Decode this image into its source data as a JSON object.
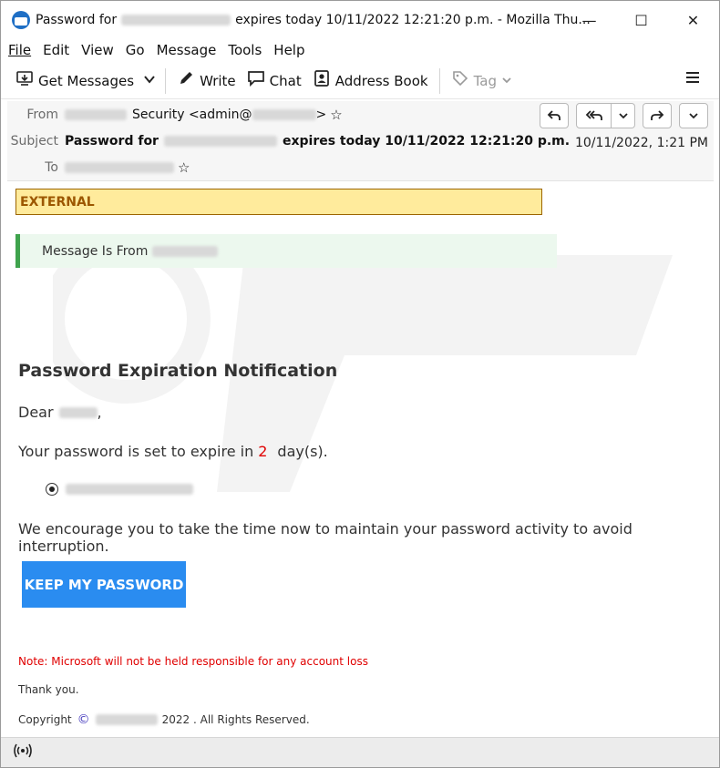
{
  "window": {
    "title_prefix": "Password for",
    "title_suffix": "expires today 10/11/2022 12:21:20 p.m. - Mozilla Thu...",
    "minimize": "—",
    "maximize": "☐",
    "close": "✕"
  },
  "menu": {
    "file": "File",
    "edit": "Edit",
    "view": "View",
    "go": "Go",
    "message": "Message",
    "tools": "Tools",
    "help": "Help"
  },
  "toolbar": {
    "get_messages": "Get Messages",
    "write": "Write",
    "chat": "Chat",
    "address_book": "Address Book",
    "tag": "Tag"
  },
  "header": {
    "from_label": "From",
    "from_name": "Security <admin@",
    "from_suffix": ">",
    "subject_label": "Subject",
    "subject_prefix": "Password for",
    "subject_suffix": "expires today 10/11/2022 12:21:20 p.m.",
    "to_label": "To",
    "date": "10/11/2022, 1:21 PM"
  },
  "body": {
    "external": "EXTERNAL",
    "message_from": "Message Is From",
    "heading": "Password Expiration Notification",
    "dear": "Dear",
    "dear_comma": ",",
    "expire_prefix": "Your password is set to expire in",
    "expire_days": "2",
    "expire_suffix": "day(s).",
    "encourage": "We encourage you to take the time now to maintain your password activity to avoid interruption.",
    "button": "KEEP MY PASSWORD",
    "note": "Note: Microsoft will not be held responsible for any account loss",
    "thanks": "Thank you.",
    "copyright_prefix": "Copyright",
    "copyright_symbol": "©",
    "copyright_suffix": "2022 . All Rights Reserved."
  },
  "colors": {
    "external_bg": "#ffeb9c",
    "external_text": "#9c5700",
    "button_bg": "#2a8cf0",
    "note_red": "#e00000",
    "green_bar": "#3fa34d"
  },
  "icons": {
    "app": "thunderbird-icon",
    "get_messages": "download-icon",
    "write": "pencil-icon",
    "chat": "chat-bubble-icon",
    "address_book": "contact-card-icon",
    "tag": "tag-icon",
    "menu": "hamburger-icon",
    "status": "radio-signal-icon"
  }
}
